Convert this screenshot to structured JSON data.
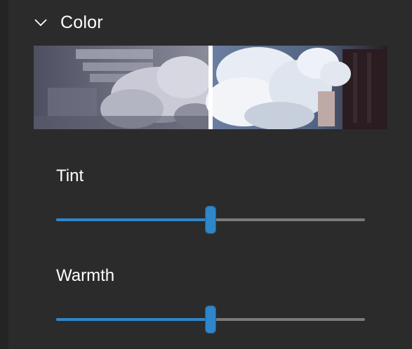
{
  "section": {
    "title": "Color",
    "expanded": true,
    "icon": "chevron-down-icon"
  },
  "sliders": [
    {
      "label": "Tint",
      "value": 0.5
    },
    {
      "label": "Warmth",
      "value": 0.5
    }
  ],
  "colors": {
    "background": "#2b2b2b",
    "accent": "#2f86c9",
    "track": "#7a7a7a",
    "text": "#ffffff"
  }
}
